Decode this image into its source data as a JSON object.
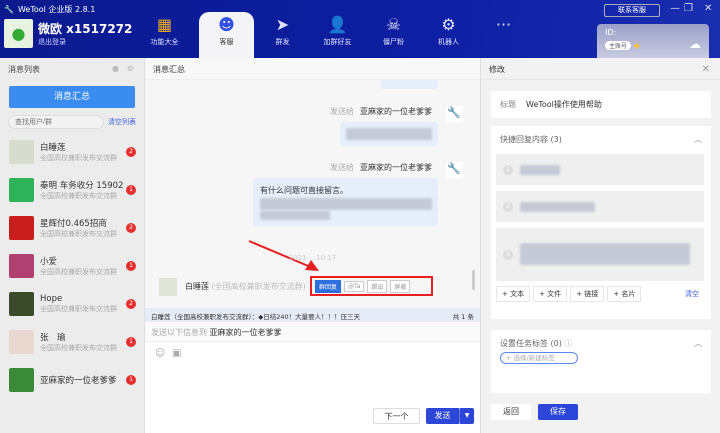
{
  "app": {
    "title": "WeTool 企业版 2.8.1",
    "user": "微欧 x1517272",
    "logout": "退出登录",
    "contact": "联系客服",
    "id_label": "ID:",
    "account_badge": "主账号"
  },
  "tabs": [
    {
      "label": "功能大全",
      "icon": "grid-icon"
    },
    {
      "label": "客服",
      "icon": "headset-icon"
    },
    {
      "label": "群发",
      "icon": "send-icon"
    },
    {
      "label": "加群好友",
      "icon": "add-user-icon"
    },
    {
      "label": "僵尸粉",
      "icon": "skull-icon"
    },
    {
      "label": "机器人",
      "icon": "robot-icon"
    },
    {
      "label": "···",
      "icon": "more-icon"
    }
  ],
  "left": {
    "title": "消息列表",
    "summary_button": "消息汇总",
    "search_placeholder": "查找用户/群",
    "clear_list": "清空列表",
    "items": [
      {
        "name": "白睡莲",
        "sub": "全国高校兼职发布交流群",
        "count": "2",
        "color": "#d8dccf"
      },
      {
        "name": "秦明 车务收分 15902",
        "sub": "全国高校兼职发布交流群",
        "count": "1",
        "color": "#2fb35a"
      },
      {
        "name": "星辉付0.465招商",
        "sub": "全国高校兼职发布交流群",
        "count": "2",
        "color": "#c81e1e"
      },
      {
        "name": "小爱",
        "sub": "全国高校兼职发布交流群",
        "count": "1",
        "color": "#b04070"
      },
      {
        "name": "Hope",
        "sub": "全国高校兼职发布交流群",
        "count": "2",
        "color": "#3a4a2a"
      },
      {
        "name": "张　瑜",
        "sub": "全国高校兼职发布交流群",
        "count": "1",
        "color": "#e8d8d0"
      },
      {
        "name": "亚麻家的一位老爹爹",
        "sub": "",
        "count": "1",
        "color": "#3a8a3a"
      }
    ]
  },
  "center": {
    "title": "消息汇总",
    "sent_to_label": "发送给",
    "recipient": "亚麻家的一位老爹爹",
    "message_text": "有什么问题可直接留言。",
    "time": "2021-…10:17",
    "group_sender": "白睡莲",
    "group_name": "(全国高校兼职发布交流群)",
    "quick_actions": [
      "群回复",
      "@Ta",
      "踢出",
      "屏蔽"
    ],
    "notice": "白睡莲（全国高校兼职发布交流群）：◆日结240！大量要人！！！压三天",
    "notice_count": "共 1 条",
    "send_to_prefix": "发送以下信息到",
    "next_button": "下一个",
    "send_button": "发送"
  },
  "right": {
    "title": "修改",
    "field_label": "标题",
    "field_value": "WeTool操作使用帮助",
    "quick_reply_title": "快捷回复内容 (3)",
    "item_numbers": [
      "1",
      "2",
      "3"
    ],
    "add_buttons": [
      "+ 文本",
      "+ 文件",
      "+ 链接",
      "+ 名片"
    ],
    "clear": "清空",
    "tags_title": "设置任务标签 (0)",
    "tag_placeholder": "+ 选择/新建标签",
    "back_button": "返回",
    "save_button": "保存"
  }
}
